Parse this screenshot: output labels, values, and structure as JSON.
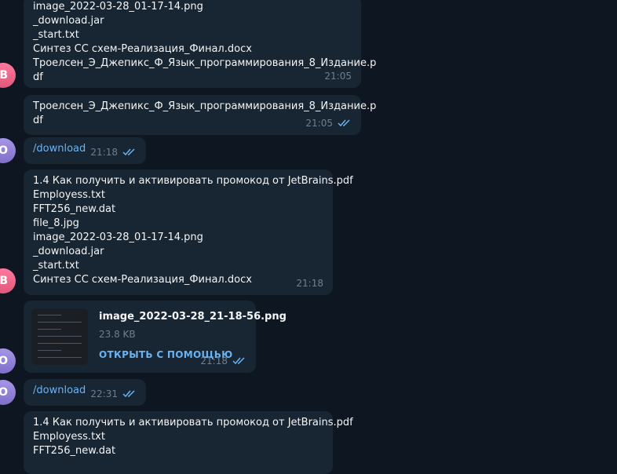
{
  "colors": {
    "background": "#0e1621",
    "bubble_in": "#182533",
    "bubble_out": "#2b5278",
    "link": "#6ab3f3",
    "time": "#6d7f8f"
  },
  "avatars": {
    "pink_initial": "B",
    "violet_initial": "O"
  },
  "messages": [
    {
      "lines": [
        "image_2022-03-28_01-17-14.png",
        "_download.jar",
        "_start.txt",
        "Синтез СС схем-Реализация_Финал.docx",
        "Троелсен_Э_Джепикс_Ф_Язык_программирования_8_Издание.p",
        "df"
      ],
      "time": "21:05"
    },
    {
      "lines": [
        "Троелсен_Э_Джепикс_Ф_Язык_программирования_8_Издание.p",
        "df"
      ],
      "time": "21:05"
    },
    {
      "text": "/download",
      "time": "21:18"
    },
    {
      "lines": [
        "1.4 Как получить и активировать промокод от JetBrains.pdf",
        "Employess.txt",
        "FFT256_new.dat",
        "file_8.jpg",
        "image_2022-03-28_01-17-14.png",
        "_download.jar",
        "_start.txt",
        "Синтез СС схем-Реализация_Финал.docx"
      ],
      "time": "21:18"
    },
    {
      "file_name": "image_2022-03-28_21-18-56.png",
      "file_size": "23.8 KB",
      "action": "ОТКРЫТЬ С ПОМОЩЬЮ",
      "time": "21:18"
    },
    {
      "text": "/download",
      "time": "22:31"
    },
    {
      "lines": [
        "1.4 Как получить и активировать промокод от JetBrains.pdf",
        "Employess.txt",
        "FFT256_new.dat"
      ]
    }
  ]
}
